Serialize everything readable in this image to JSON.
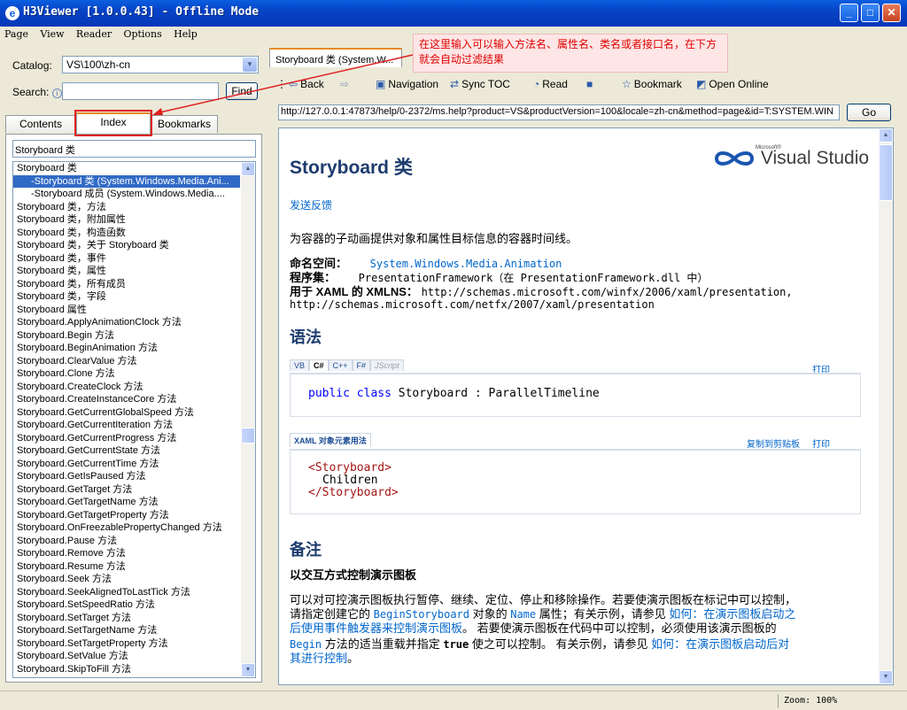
{
  "window": {
    "title": "H3Viewer [1.0.0.43] - Offline Mode",
    "min_label": "_",
    "max_label": "□",
    "close_label": "✕"
  },
  "menu": [
    "Page",
    "View",
    "Reader",
    "Options",
    "Help"
  ],
  "left": {
    "catalog_label": "Catalog:",
    "catalog_value": "VS\\100\\zh-cn",
    "search_label": "Search:",
    "search_value": "",
    "find_label": "Find",
    "tabs": [
      "Contents",
      "Index",
      "Bookmarks"
    ],
    "active_tab": "Index",
    "filter_value": "Storyboard 类",
    "items": [
      {
        "text": "Storyboard 类",
        "level": 0,
        "selected": false
      },
      {
        "text": "-Storyboard 类 (System.Windows.Media.Ani...",
        "level": 1,
        "selected": true
      },
      {
        "text": "-Storyboard 成员 (System.Windows.Media....",
        "level": 1,
        "selected": false
      },
      {
        "text": "Storyboard 类，方法",
        "level": 0,
        "selected": false
      },
      {
        "text": "Storyboard 类，附加属性",
        "level": 0,
        "selected": false
      },
      {
        "text": "Storyboard 类，构造函数",
        "level": 0,
        "selected": false
      },
      {
        "text": "Storyboard 类，关于 Storyboard 类",
        "level": 0,
        "selected": false
      },
      {
        "text": "Storyboard 类，事件",
        "level": 0,
        "selected": false
      },
      {
        "text": "Storyboard 类，属性",
        "level": 0,
        "selected": false
      },
      {
        "text": "Storyboard 类，所有成员",
        "level": 0,
        "selected": false
      },
      {
        "text": "Storyboard 类，字段",
        "level": 0,
        "selected": false
      },
      {
        "text": "Storyboard 属性",
        "level": 0,
        "selected": false
      },
      {
        "text": "Storyboard.ApplyAnimationClock 方法",
        "level": 0,
        "selected": false
      },
      {
        "text": "Storyboard.Begin 方法",
        "level": 0,
        "selected": false
      },
      {
        "text": "Storyboard.BeginAnimation 方法",
        "level": 0,
        "selected": false
      },
      {
        "text": "Storyboard.ClearValue 方法",
        "level": 0,
        "selected": false
      },
      {
        "text": "Storyboard.Clone 方法",
        "level": 0,
        "selected": false
      },
      {
        "text": "Storyboard.CreateClock 方法",
        "level": 0,
        "selected": false
      },
      {
        "text": "Storyboard.CreateInstanceCore 方法",
        "level": 0,
        "selected": false
      },
      {
        "text": "Storyboard.GetCurrentGlobalSpeed 方法",
        "level": 0,
        "selected": false
      },
      {
        "text": "Storyboard.GetCurrentIteration 方法",
        "level": 0,
        "selected": false
      },
      {
        "text": "Storyboard.GetCurrentProgress 方法",
        "level": 0,
        "selected": false
      },
      {
        "text": "Storyboard.GetCurrentState 方法",
        "level": 0,
        "selected": false
      },
      {
        "text": "Storyboard.GetCurrentTime 方法",
        "level": 0,
        "selected": false
      },
      {
        "text": "Storyboard.GetIsPaused 方法",
        "level": 0,
        "selected": false
      },
      {
        "text": "Storyboard.GetTarget 方法",
        "level": 0,
        "selected": false
      },
      {
        "text": "Storyboard.GetTargetName 方法",
        "level": 0,
        "selected": false
      },
      {
        "text": "Storyboard.GetTargetProperty 方法",
        "level": 0,
        "selected": false
      },
      {
        "text": "Storyboard.OnFreezablePropertyChanged 方法",
        "level": 0,
        "selected": false
      },
      {
        "text": "Storyboard.Pause 方法",
        "level": 0,
        "selected": false
      },
      {
        "text": "Storyboard.Remove 方法",
        "level": 0,
        "selected": false
      },
      {
        "text": "Storyboard.Resume 方法",
        "level": 0,
        "selected": false
      },
      {
        "text": "Storyboard.Seek 方法",
        "level": 0,
        "selected": false
      },
      {
        "text": "Storyboard.SeekAlignedToLastTick 方法",
        "level": 0,
        "selected": false
      },
      {
        "text": "Storyboard.SetSpeedRatio 方法",
        "level": 0,
        "selected": false
      },
      {
        "text": "Storyboard.SetTarget 方法",
        "level": 0,
        "selected": false
      },
      {
        "text": "Storyboard.SetTargetName 方法",
        "level": 0,
        "selected": false
      },
      {
        "text": "Storyboard.SetTargetProperty 方法",
        "level": 0,
        "selected": false
      },
      {
        "text": "Storyboard.SetValue 方法",
        "level": 0,
        "selected": false
      },
      {
        "text": "Storyboard.SkipToFill 方法",
        "level": 0,
        "selected": false
      }
    ]
  },
  "right": {
    "doc_tab": "Storyboard 类 (System.W...",
    "toolbar": {
      "back": "Back",
      "forward": "⇨",
      "navigation": "Navigation",
      "sync_toc": "Sync TOC",
      "read": "Read",
      "bookmark": "Bookmark",
      "open_online": "Open Online"
    },
    "url": "http://127.0.0.1:47873/help/0-2372/ms.help?product=VS&productVersion=100&locale=zh-cn&method=page&id=T:SYSTEM.WIN",
    "go_label": "Go",
    "page": {
      "title": "Storyboard 类",
      "logo_ms": "Microsoft®",
      "logo_text": "Visual Studio",
      "feedback": "发送反馈",
      "summary": "为容器的子动画提供对象和属性目标信息的容器时间线。",
      "ns_label": "命名空间：",
      "ns_value": "System.Windows.Media.Animation",
      "asm_label": "程序集：",
      "asm_value": "PresentationFramework（在 PresentationFramework.dll 中）",
      "xmlns_label": "用于 XAML 的 XMLNS：",
      "xmlns_value": "http://schemas.microsoft.com/winfx/2006/xaml/presentation,",
      "xmlns_value2": "http://schemas.microsoft.com/netfx/2007/xaml/presentation",
      "syntax_heading": "语法",
      "code_tabs": [
        "VB",
        "C#",
        "C++",
        "F#",
        "JScript"
      ],
      "print": "打印",
      "code_kw1": "public",
      "code_kw2": "class",
      "code_rest": " Storyboard : ParallelTimeline",
      "xaml_tab": "XAML 对象元素用法",
      "copy": "复制到剪贴板",
      "xaml_line1": "<Storyboard>",
      "xaml_line2": "Children",
      "xaml_line3": "</Storyboard>",
      "remarks_heading": "备注",
      "remarks_sub": "以交互方式控制演示图板",
      "r1a": "可以对可控演示图板执行暂停、继续、定位、停止和移除操作。若要使演示图板在标记中可以控制，",
      "r2a": "请指定创建它的 ",
      "r2b": "BeginStoryboard",
      "r2c": " 对象的 ",
      "r2d": "Name",
      "r2e": " 属性；有关示例，请参见 ",
      "r2f": "如何：在演示图板启动之",
      "r3a": "后使用事件触发器来控制演示图板",
      "r3b": "。 若要使演示图板在代码中可以控制，必须使用该演示图板的",
      "r4a": "Begin",
      "r4b": " 方法的适当重载并指定 ",
      "r4c": "true",
      "r4d": " 使之可以控制。 有关示例，请参见 ",
      "r4e": "如何：在演示图板启动后对",
      "r5a": "其进行控制",
      "r5b": "。"
    }
  },
  "annotation": {
    "text": "在这里输入可以输入方法名、属性名、类名或者接口名，在下方就会自动过滤结果",
    "color": "#E00000"
  },
  "status": {
    "zoom": "Zoom: 100%"
  }
}
